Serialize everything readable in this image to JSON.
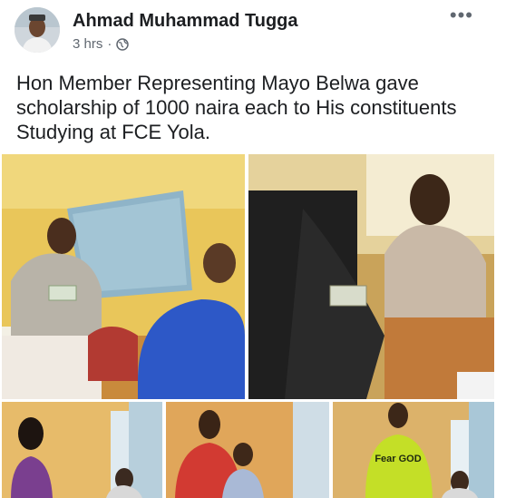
{
  "post": {
    "author": "Ahmad Muhammad Tugga",
    "time": "3 hrs",
    "separator": "·",
    "privacy_icon": "globe-icon",
    "more_icon": "more-options-icon",
    "more_glyph": "•••",
    "text": "Hon Member Representing Mayo Belwa gave scholarship of 1000 naira each to His constituents Studying at FCE Yola.",
    "photos": [
      {
        "name": "photo-1"
      },
      {
        "name": "photo-2"
      },
      {
        "name": "photo-3"
      },
      {
        "name": "photo-4"
      },
      {
        "name": "photo-5"
      }
    ],
    "shirt_text": "Fear GOD"
  }
}
